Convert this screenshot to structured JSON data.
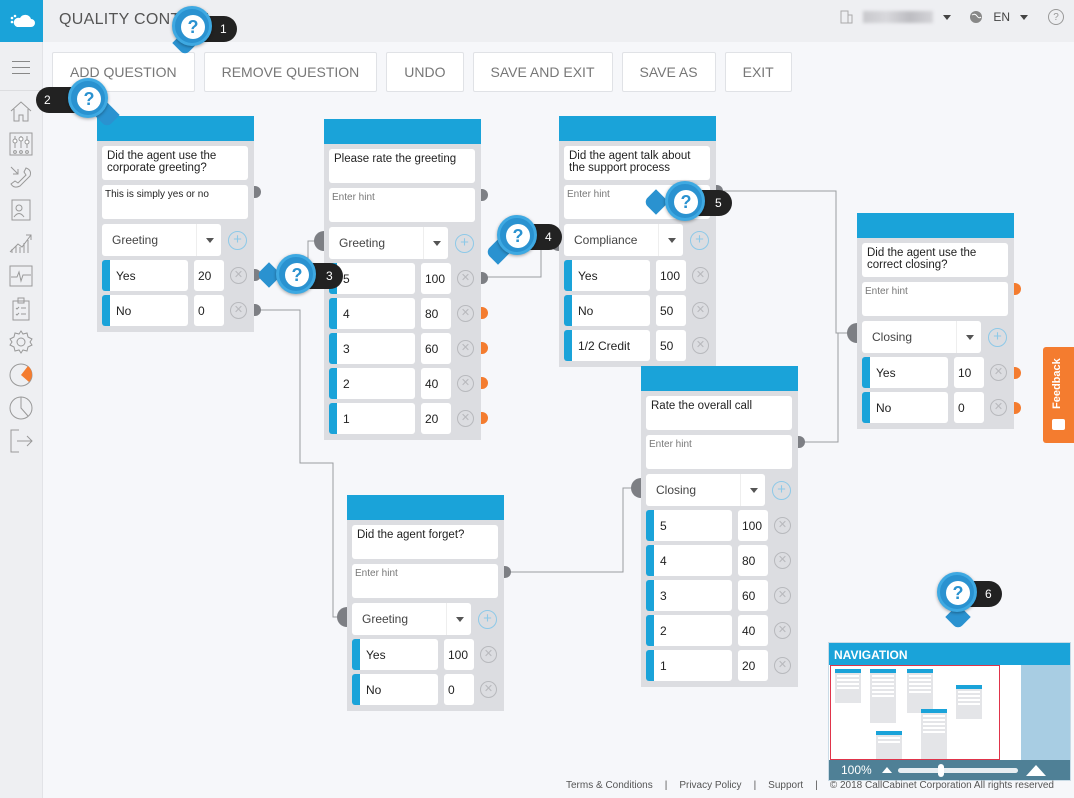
{
  "header": {
    "title": "QUALITY CONTROL",
    "language": "EN",
    "account_name_blurred": true
  },
  "toolbar": {
    "buttons": [
      "ADD QUESTION",
      "REMOVE QUESTION",
      "UNDO",
      "SAVE AND EXIT",
      "SAVE AS",
      "EXIT"
    ]
  },
  "sidebar": {
    "items": [
      "menu",
      "home",
      "mixer-settings",
      "calls",
      "contacts",
      "analytics",
      "monitoring",
      "checklist",
      "settings",
      "quality-pie",
      "reports-pie",
      "logout"
    ]
  },
  "cards": [
    {
      "question": "Did the agent use the corporate greeting?",
      "hint": "This is simply yes or no",
      "hint_placeholder": "Enter hint",
      "category": "Greeting",
      "answers": [
        {
          "label": "Yes",
          "score": "20"
        },
        {
          "label": "No",
          "score": "0"
        }
      ]
    },
    {
      "question": "Please rate the greeting",
      "hint": "",
      "hint_placeholder": "Enter hint",
      "category": "Greeting",
      "answers": [
        {
          "label": "5",
          "score": "100"
        },
        {
          "label": "4",
          "score": "80"
        },
        {
          "label": "3",
          "score": "60"
        },
        {
          "label": "2",
          "score": "40"
        },
        {
          "label": "1",
          "score": "20"
        }
      ]
    },
    {
      "question": "Did the agent talk about the support process",
      "hint": "",
      "hint_placeholder": "Enter hint",
      "category": "Compliance",
      "answers": [
        {
          "label": "Yes",
          "score": "100"
        },
        {
          "label": "No",
          "score": "50"
        },
        {
          "label": "1/2 Credit",
          "score": "50"
        }
      ]
    },
    {
      "question": "Did the agent use the correct closing?",
      "hint": "",
      "hint_placeholder": "Enter hint",
      "category": "Closing",
      "answers": [
        {
          "label": "Yes",
          "score": "10"
        },
        {
          "label": "No",
          "score": "0"
        }
      ]
    },
    {
      "question": "Rate the overall call",
      "hint": "",
      "hint_placeholder": "Enter hint",
      "category": "Closing",
      "answers": [
        {
          "label": "5",
          "score": "100"
        },
        {
          "label": "4",
          "score": "80"
        },
        {
          "label": "3",
          "score": "60"
        },
        {
          "label": "2",
          "score": "40"
        },
        {
          "label": "1",
          "score": "20"
        }
      ]
    },
    {
      "question": "Did the agent forget?",
      "hint": "",
      "hint_placeholder": "Enter hint",
      "category": "Greeting",
      "answers": [
        {
          "label": "Yes",
          "score": "100"
        },
        {
          "label": "No",
          "score": "0"
        }
      ]
    }
  ],
  "callouts": [
    "1",
    "2",
    "3",
    "4",
    "5",
    "6"
  ],
  "feedback": {
    "label": "Feedback"
  },
  "navigation": {
    "title": "NAVIGATION",
    "zoom": "100%"
  },
  "footer": {
    "links": [
      "Terms & Conditions",
      "Privacy Policy",
      "Support"
    ],
    "copyright": "© 2018 CallCabinet Corporation All rights reserved"
  },
  "colors": {
    "accent": "#1aa3d9",
    "orange": "#f47c2f",
    "card_bg": "#dcdde1"
  }
}
